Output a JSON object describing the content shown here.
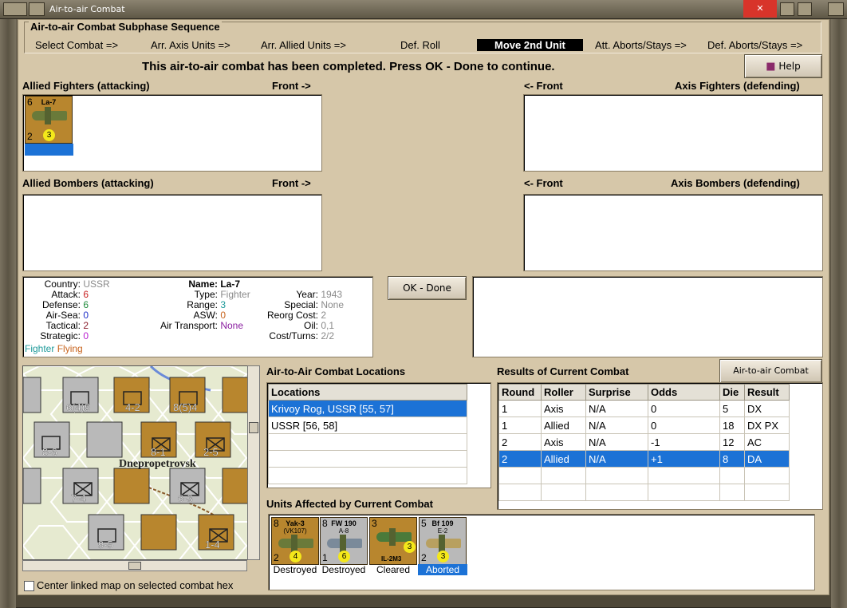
{
  "window": {
    "title": "Air-to-air Combat"
  },
  "sequence": {
    "title": "Air-to-air Combat Subphase Sequence",
    "steps": [
      "Select Combat =>",
      "Arr. Axis Units =>",
      "Arr. Allied Units =>",
      "Def. Roll",
      "Move 2nd Unit",
      "Att. Aborts/Stays =>",
      "Def. Aborts/Stays =>"
    ],
    "active_step": "Move 2nd Unit"
  },
  "status_message": "This air-to-air combat has been completed.  Press OK - Done to continue.",
  "buttons": {
    "help": "Help",
    "ok": "OK - Done",
    "chart": "Air-to-air Combat Chart"
  },
  "boxes": {
    "allied_fighters": "Allied Fighters (attacking)",
    "allied_bombers": "Allied Bombers (attacking)",
    "axis_fighters": "Axis Fighters (defending)",
    "axis_bombers": "Axis Bombers (defending)",
    "front_right": "Front ->",
    "front_left": "<- Front"
  },
  "allied_fighter_counter": {
    "attack": "6",
    "name": "La-7",
    "defense": "2",
    "range": "3"
  },
  "unit_info": {
    "country_label": "Country:",
    "country": "USSR",
    "attack_label": "Attack:",
    "attack": "6",
    "defense_label": "Defense:",
    "defense": "6",
    "airsea_label": "Air-Sea:",
    "airsea": "0",
    "tactical_label": "Tactical:",
    "tactical": "2",
    "strategic_label": "Strategic:",
    "strategic": "0",
    "class": "Fighter",
    "state": "Flying",
    "name_label": "Name:",
    "name": "La-7",
    "type_label": "Type:",
    "type": "Fighter",
    "range_label": "Range:",
    "range": "3",
    "asw_label": "ASW:",
    "asw": "0",
    "air_transport_label": "Air Transport:",
    "air_transport": "None",
    "year_label": "Year:",
    "year": "1943",
    "special_label": "Special:",
    "special": "None",
    "reorg_label": "Reorg Cost:",
    "reorg": "2",
    "oil_label": "Oil:",
    "oil": "0,1",
    "cost_label": "Cost/Turns:",
    "cost": "2/2"
  },
  "locations": {
    "title": "Air-to-Air Combat Locations",
    "header": "Locations",
    "rows": [
      "Krivoy Rog, USSR [55, 57]",
      "USSR [56, 58]"
    ]
  },
  "results": {
    "title": "Results of Current Combat",
    "columns": [
      "Round",
      "Roller",
      "Surprise",
      "Odds",
      "Die",
      "Result"
    ],
    "rows": [
      [
        "1",
        "Axis",
        "N/A",
        "0",
        "5",
        "DX"
      ],
      [
        "1",
        "Allied",
        "N/A",
        "0",
        "18",
        "DX PX"
      ],
      [
        "2",
        "Axis",
        "N/A",
        "-1",
        "12",
        "AC"
      ],
      [
        "2",
        "Allied",
        "N/A",
        "+1",
        "8",
        "DA"
      ]
    ]
  },
  "affected": {
    "title": "Units Affected by Current Combat",
    "units": [
      {
        "name": "Yak-3",
        "sub": "(VK107)",
        "attack": "8",
        "defense": "2",
        "range": "4",
        "status": "Destroyed",
        "color": "#b8862e"
      },
      {
        "name": "FW 190",
        "sub": "A-8",
        "attack": "8",
        "defense": "1",
        "range": "6",
        "status": "Destroyed",
        "color": "#b9b9b9"
      },
      {
        "name": "IL-2M3",
        "sub": "",
        "attack": "3",
        "defense": "",
        "range": "3",
        "status": "Cleared",
        "color": "#b8862e"
      },
      {
        "name": "Bf 109",
        "sub": "E-2",
        "attack": "5",
        "defense": "2",
        "range": "3",
        "status": "Aborted",
        "color": "#b9b9b9"
      }
    ]
  },
  "map": {
    "city": "Dnepropetrovsk",
    "center_checkbox": "Center linked map on selected combat hex"
  },
  "colors": {
    "selection": "#1c72d6",
    "panel": "#d6c7a9",
    "counter_gold": "#b8862e"
  }
}
